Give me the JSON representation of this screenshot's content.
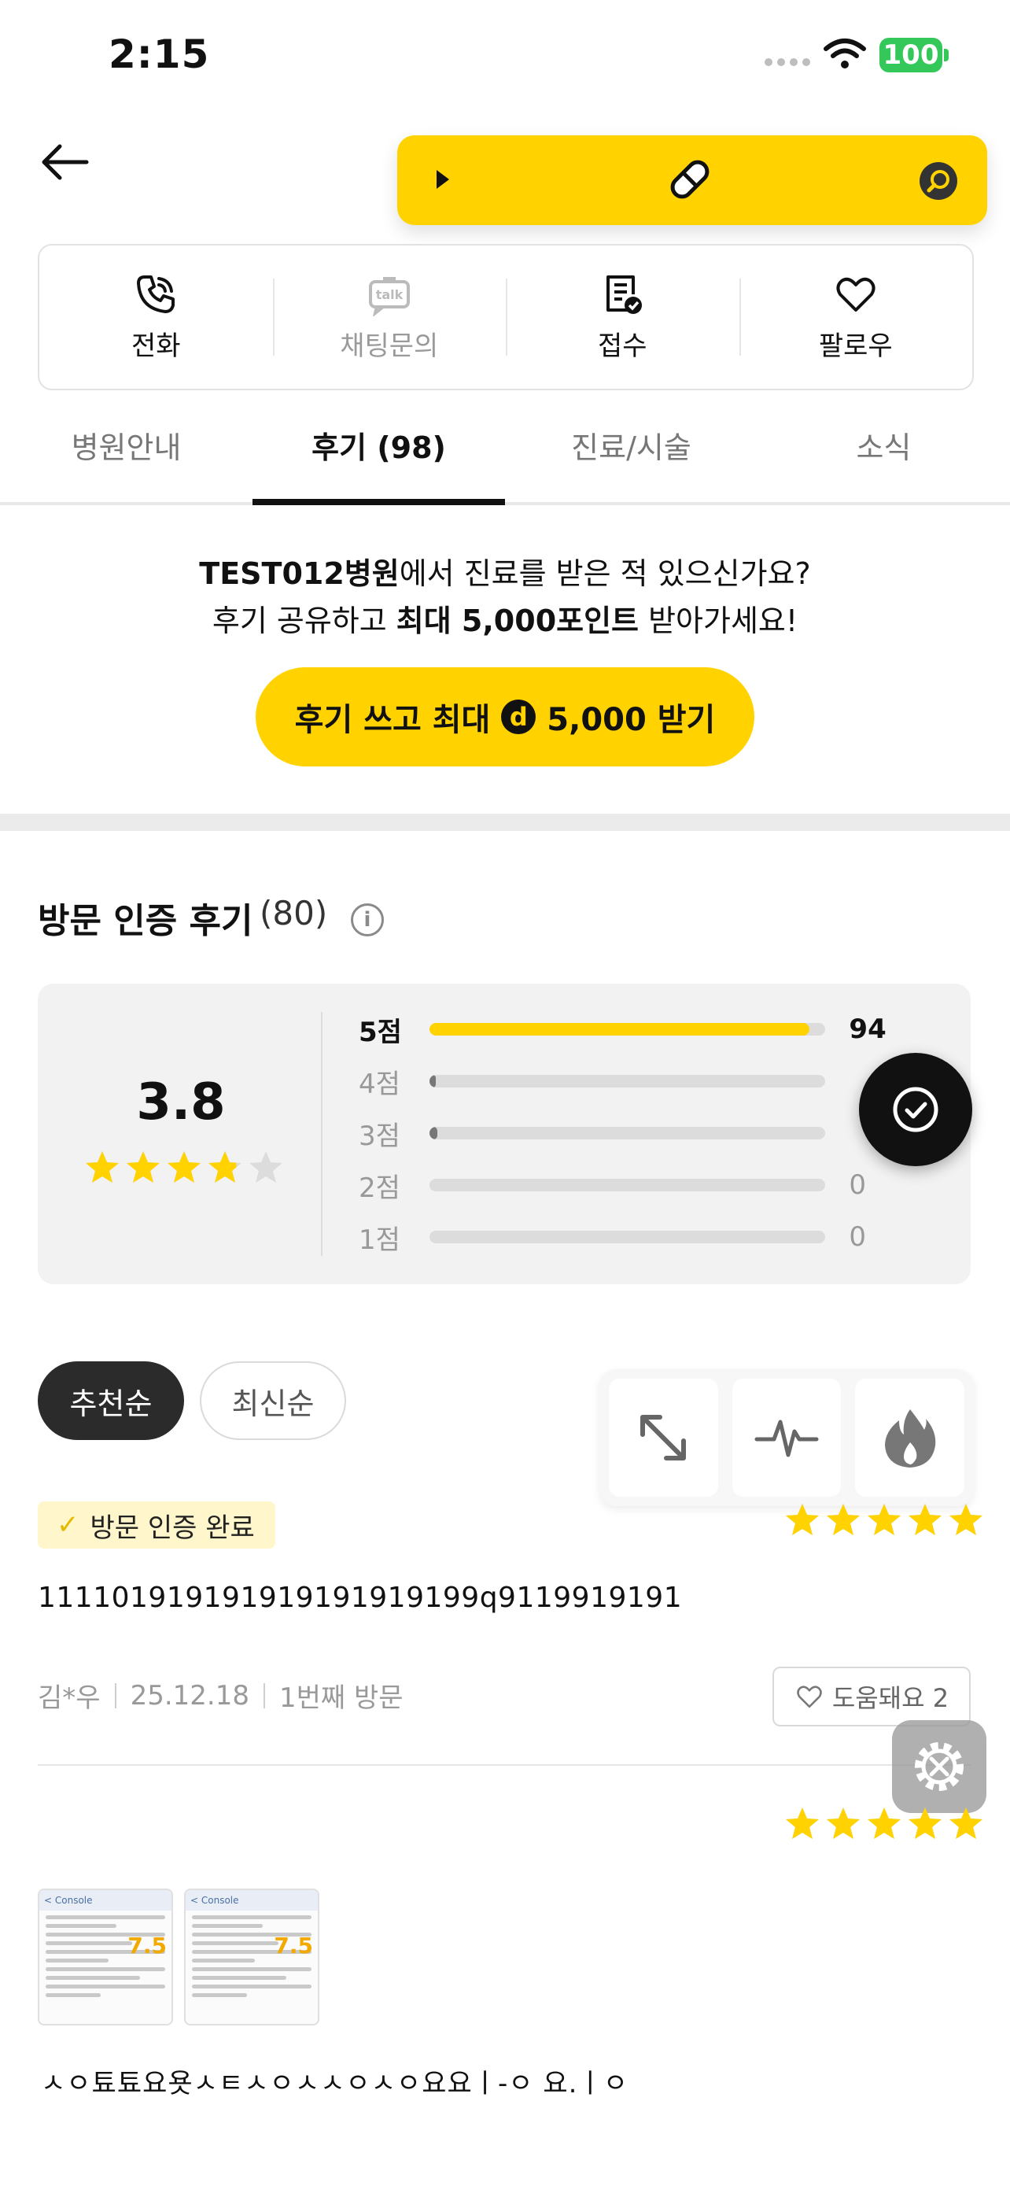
{
  "status": {
    "time": "2:15",
    "battery": "100"
  },
  "colors": {
    "accent": "#ffd200",
    "dark": "#111111"
  },
  "header": {
    "back_icon": "arrow-left-icon",
    "search_bar_icons": [
      "play-icon",
      "pill-icon",
      "search-icon"
    ]
  },
  "actions": [
    {
      "label": "전화",
      "icon": "phone-icon"
    },
    {
      "label": "채팅문의",
      "icon": "talk-icon"
    },
    {
      "label": "접수",
      "icon": "clipboard-check-icon"
    },
    {
      "label": "팔로우",
      "icon": "heart-icon"
    }
  ],
  "tabs": [
    {
      "label": "병원안내"
    },
    {
      "label": "후기 (98)",
      "active": true
    },
    {
      "label": "진료/시술"
    },
    {
      "label": "소식"
    }
  ],
  "promo": {
    "hospital": "TEST012병원",
    "line1_rest": "에서 진료를 받은 적 있으신가요?",
    "line2_pre": "후기 공유하고 ",
    "line2_bold": "최대 5,000포인트",
    "line2_post": " 받아가세요!",
    "button_pre": "후기 쓰고 최대",
    "button_post": "5,000 받기",
    "coin_letter": "d"
  },
  "verified": {
    "title": "방문 인증 후기",
    "count": "(80)",
    "info": "i",
    "average": "3.8",
    "average_stars": 3.8,
    "distribution": [
      {
        "label": "5점",
        "count": "94",
        "fraction": 0.96
      },
      {
        "label": "4점",
        "count": "",
        "fraction": 0.005
      },
      {
        "label": "3점",
        "count": "",
        "fraction": 0.02
      },
      {
        "label": "2점",
        "count": "0",
        "fraction": 0
      },
      {
        "label": "1점",
        "count": "0",
        "fraction": 0
      }
    ]
  },
  "sort": {
    "recommended": "추천순",
    "latest": "최신순"
  },
  "tools": [
    "expand-icon",
    "pulse-icon",
    "flame-icon"
  ],
  "reviews": [
    {
      "badge": "방문 인증 완료",
      "stars": 5,
      "text": "111101919191919191919199q9119919191",
      "author": "김*우",
      "date": "25.12.18",
      "visit": "1번째 방문",
      "helpful": "도움돼요 2"
    },
    {
      "stars": 5,
      "thumb_number": "7.5",
      "thumb_header": "< Console",
      "text": "ㅅㅇ툐툐요욧ㅅㅌㅅㅇㅅㅅㅇㅅㅇ요요ㅣ-ㅇ 요.ㅣㅇ"
    }
  ]
}
